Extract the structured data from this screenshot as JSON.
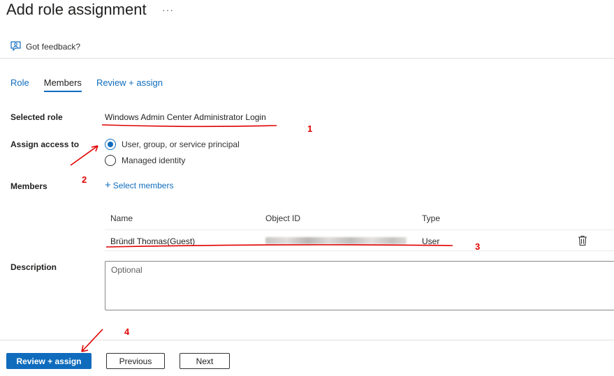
{
  "header": {
    "title": "Add role assignment",
    "more_label": "···"
  },
  "feedback": {
    "label": "Got feedback?"
  },
  "tabs": [
    {
      "label": "Role"
    },
    {
      "label": "Members"
    },
    {
      "label": "Review + assign"
    }
  ],
  "form": {
    "selected_role_label": "Selected role",
    "selected_role_value": "Windows Admin Center Administrator Login",
    "assign_access_label": "Assign access to",
    "assign_options": [
      {
        "label": "User, group, or service principal",
        "selected": true
      },
      {
        "label": "Managed identity",
        "selected": false
      }
    ],
    "members_label": "Members",
    "select_members_label": "Select members",
    "table": {
      "columns": [
        "Name",
        "Object ID",
        "Type"
      ],
      "rows": [
        {
          "name": "Bründl Thomas(Guest)",
          "type": "User"
        }
      ]
    },
    "description_label": "Description",
    "description_placeholder": "Optional"
  },
  "footer": {
    "review_assign": "Review + assign",
    "previous": "Previous",
    "next": "Next"
  },
  "annotations": [
    "1",
    "2",
    "3",
    "4"
  ],
  "colors": {
    "accent": "#0f6cbd",
    "annotation": "#e00000"
  }
}
